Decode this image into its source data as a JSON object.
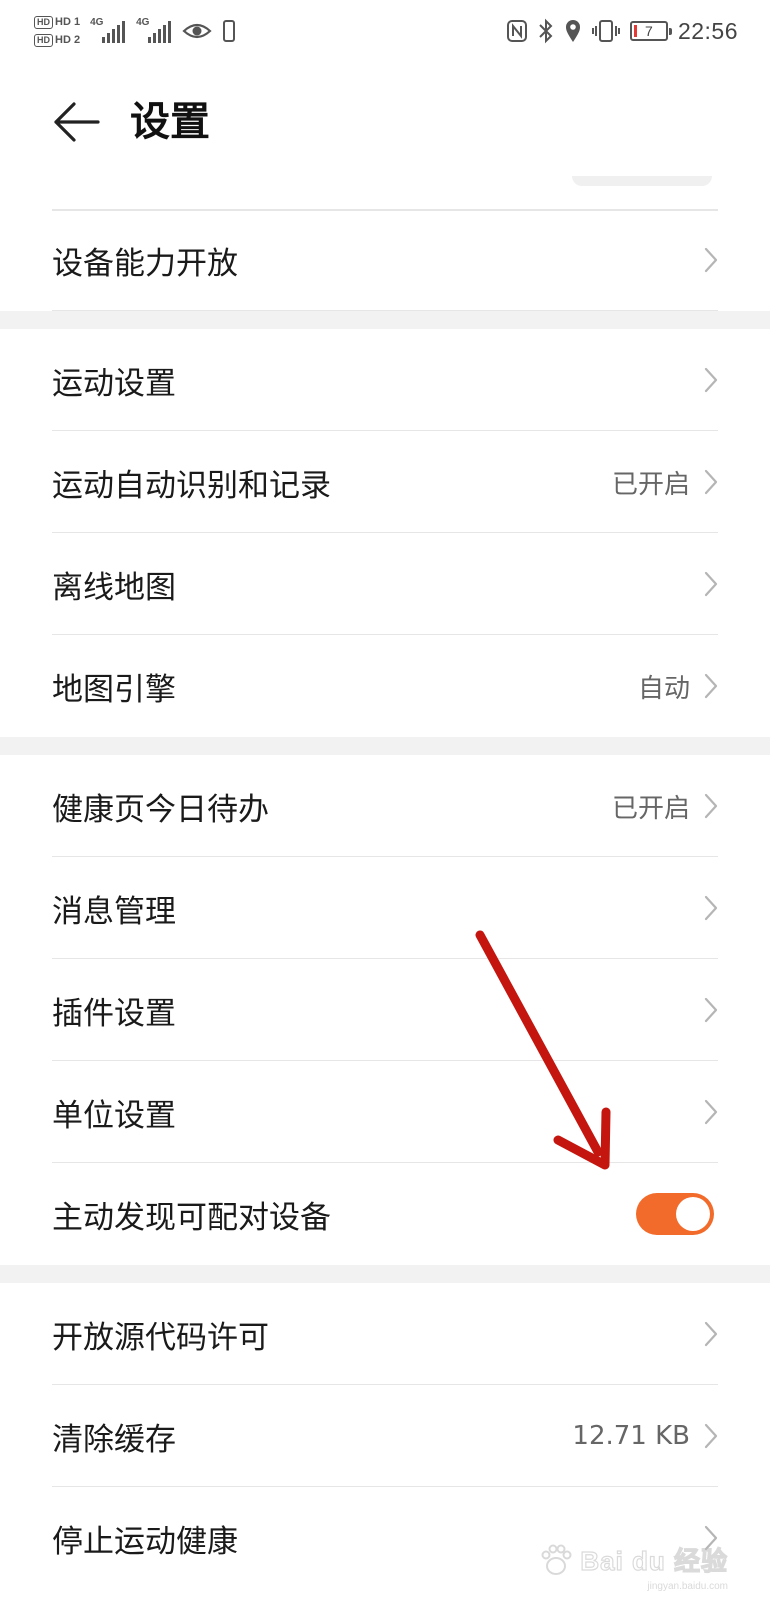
{
  "status_bar": {
    "sim1": "HD 1",
    "sim2": "HD 2",
    "net1": "4G",
    "net2": "4G",
    "battery_level": "7",
    "battery_color": "#e53935",
    "time": "22:56",
    "icons": [
      "nfc-icon",
      "bluetooth-icon",
      "location-icon",
      "vibrate-icon",
      "battery-icon",
      "eye-icon",
      "phone-icon"
    ]
  },
  "header": {
    "title": "设置",
    "back_icon": "arrow-left-icon"
  },
  "groups": [
    {
      "rows": [
        {
          "label": "设备能力开放",
          "value": "",
          "control": "chevron"
        }
      ]
    },
    {
      "rows": [
        {
          "label": "运动设置",
          "value": "",
          "control": "chevron"
        },
        {
          "label": "运动自动识别和记录",
          "value": "已开启",
          "control": "chevron"
        },
        {
          "label": "离线地图",
          "value": "",
          "control": "chevron"
        },
        {
          "label": "地图引擎",
          "value": "自动",
          "control": "chevron"
        }
      ]
    },
    {
      "rows": [
        {
          "label": "健康页今日待办",
          "value": "已开启",
          "control": "chevron"
        },
        {
          "label": "消息管理",
          "value": "",
          "control": "chevron"
        },
        {
          "label": "插件设置",
          "value": "",
          "control": "chevron"
        },
        {
          "label": "单位设置",
          "value": "",
          "control": "chevron"
        },
        {
          "label": "主动发现可配对设备",
          "value": "",
          "control": "toggle",
          "toggle_on": true
        }
      ]
    },
    {
      "rows": [
        {
          "label": "开放源代码许可",
          "value": "",
          "control": "chevron"
        },
        {
          "label": "清除缓存",
          "value": "12.71 KB",
          "control": "chevron"
        },
        {
          "label": "停止运动健康",
          "value": "",
          "control": "chevron"
        }
      ]
    }
  ],
  "colors": {
    "accent": "#f26b2a",
    "annotation_arrow": "#c4160f",
    "divider": "#e6e6e6",
    "group_gap": "#f2f2f2"
  },
  "watermark": {
    "text": "Bai du 经验",
    "sub": "jingyan.baidu.com"
  }
}
